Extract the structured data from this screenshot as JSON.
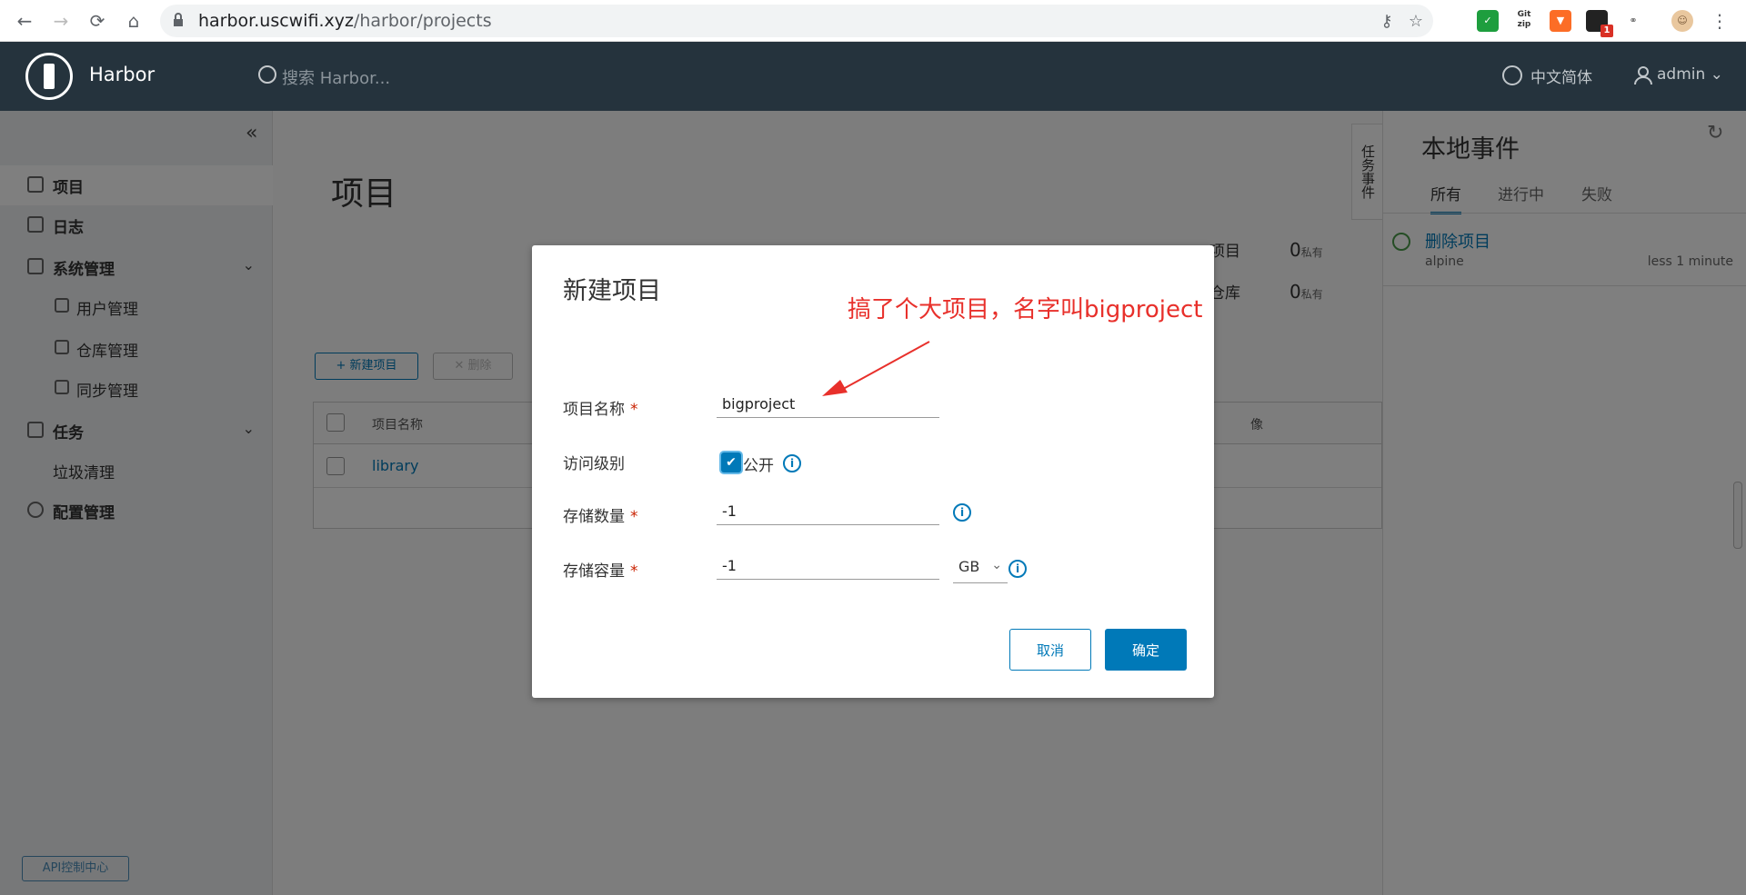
{
  "browser": {
    "url_host": "harbor.uscwifi.xyz",
    "url_path": "/harbor/projects",
    "ext_gitzip": "Git\nzip",
    "ext_badge": "1"
  },
  "header": {
    "app_name": "Harbor",
    "search_placeholder": "搜索 Harbor...",
    "language": "中文简体",
    "user": "admin"
  },
  "sidebar": {
    "items": [
      {
        "label": "项目"
      },
      {
        "label": "日志"
      },
      {
        "label": "系统管理"
      },
      {
        "label": "用户管理"
      },
      {
        "label": "仓库管理"
      },
      {
        "label": "同步管理"
      },
      {
        "label": "任务"
      },
      {
        "label": "垃圾清理"
      },
      {
        "label": "配置管理"
      }
    ],
    "api_button": "API控制中心"
  },
  "main": {
    "title": "项目",
    "stat1_label": "项目",
    "stat1_num": "0",
    "stat1_unit": "私有",
    "stat2_label": "仓库",
    "stat2_num": "0",
    "stat2_unit": "私有",
    "new_project_button": "+ 新建项目",
    "delete_button": "✕ 删除",
    "grid": {
      "col_name": "项目名称",
      "col_other": "像",
      "rows": [
        {
          "name": "library"
        }
      ]
    }
  },
  "right_panel": {
    "vertical_tab": "任务事件",
    "title": "本地事件",
    "tabs": [
      "所有",
      "进行中",
      "失败"
    ],
    "event": {
      "title": "删除项目",
      "subtitle": "alpine",
      "time": "less 1 minute"
    }
  },
  "modal": {
    "title": "新建项目",
    "name_label": "项目名称",
    "name_value": "bigproject",
    "access_label": "访问级别",
    "public_label": "公开",
    "count_label": "存储数量",
    "count_value": "-1",
    "capacity_label": "存储容量",
    "capacity_value": "-1",
    "capacity_unit": "GB",
    "required_mark": "*",
    "cancel_button": "取消",
    "ok_button": "确定"
  },
  "annotation": {
    "text": "搞了个大项目，名字叫bigproject",
    "color": "#e8302b"
  }
}
